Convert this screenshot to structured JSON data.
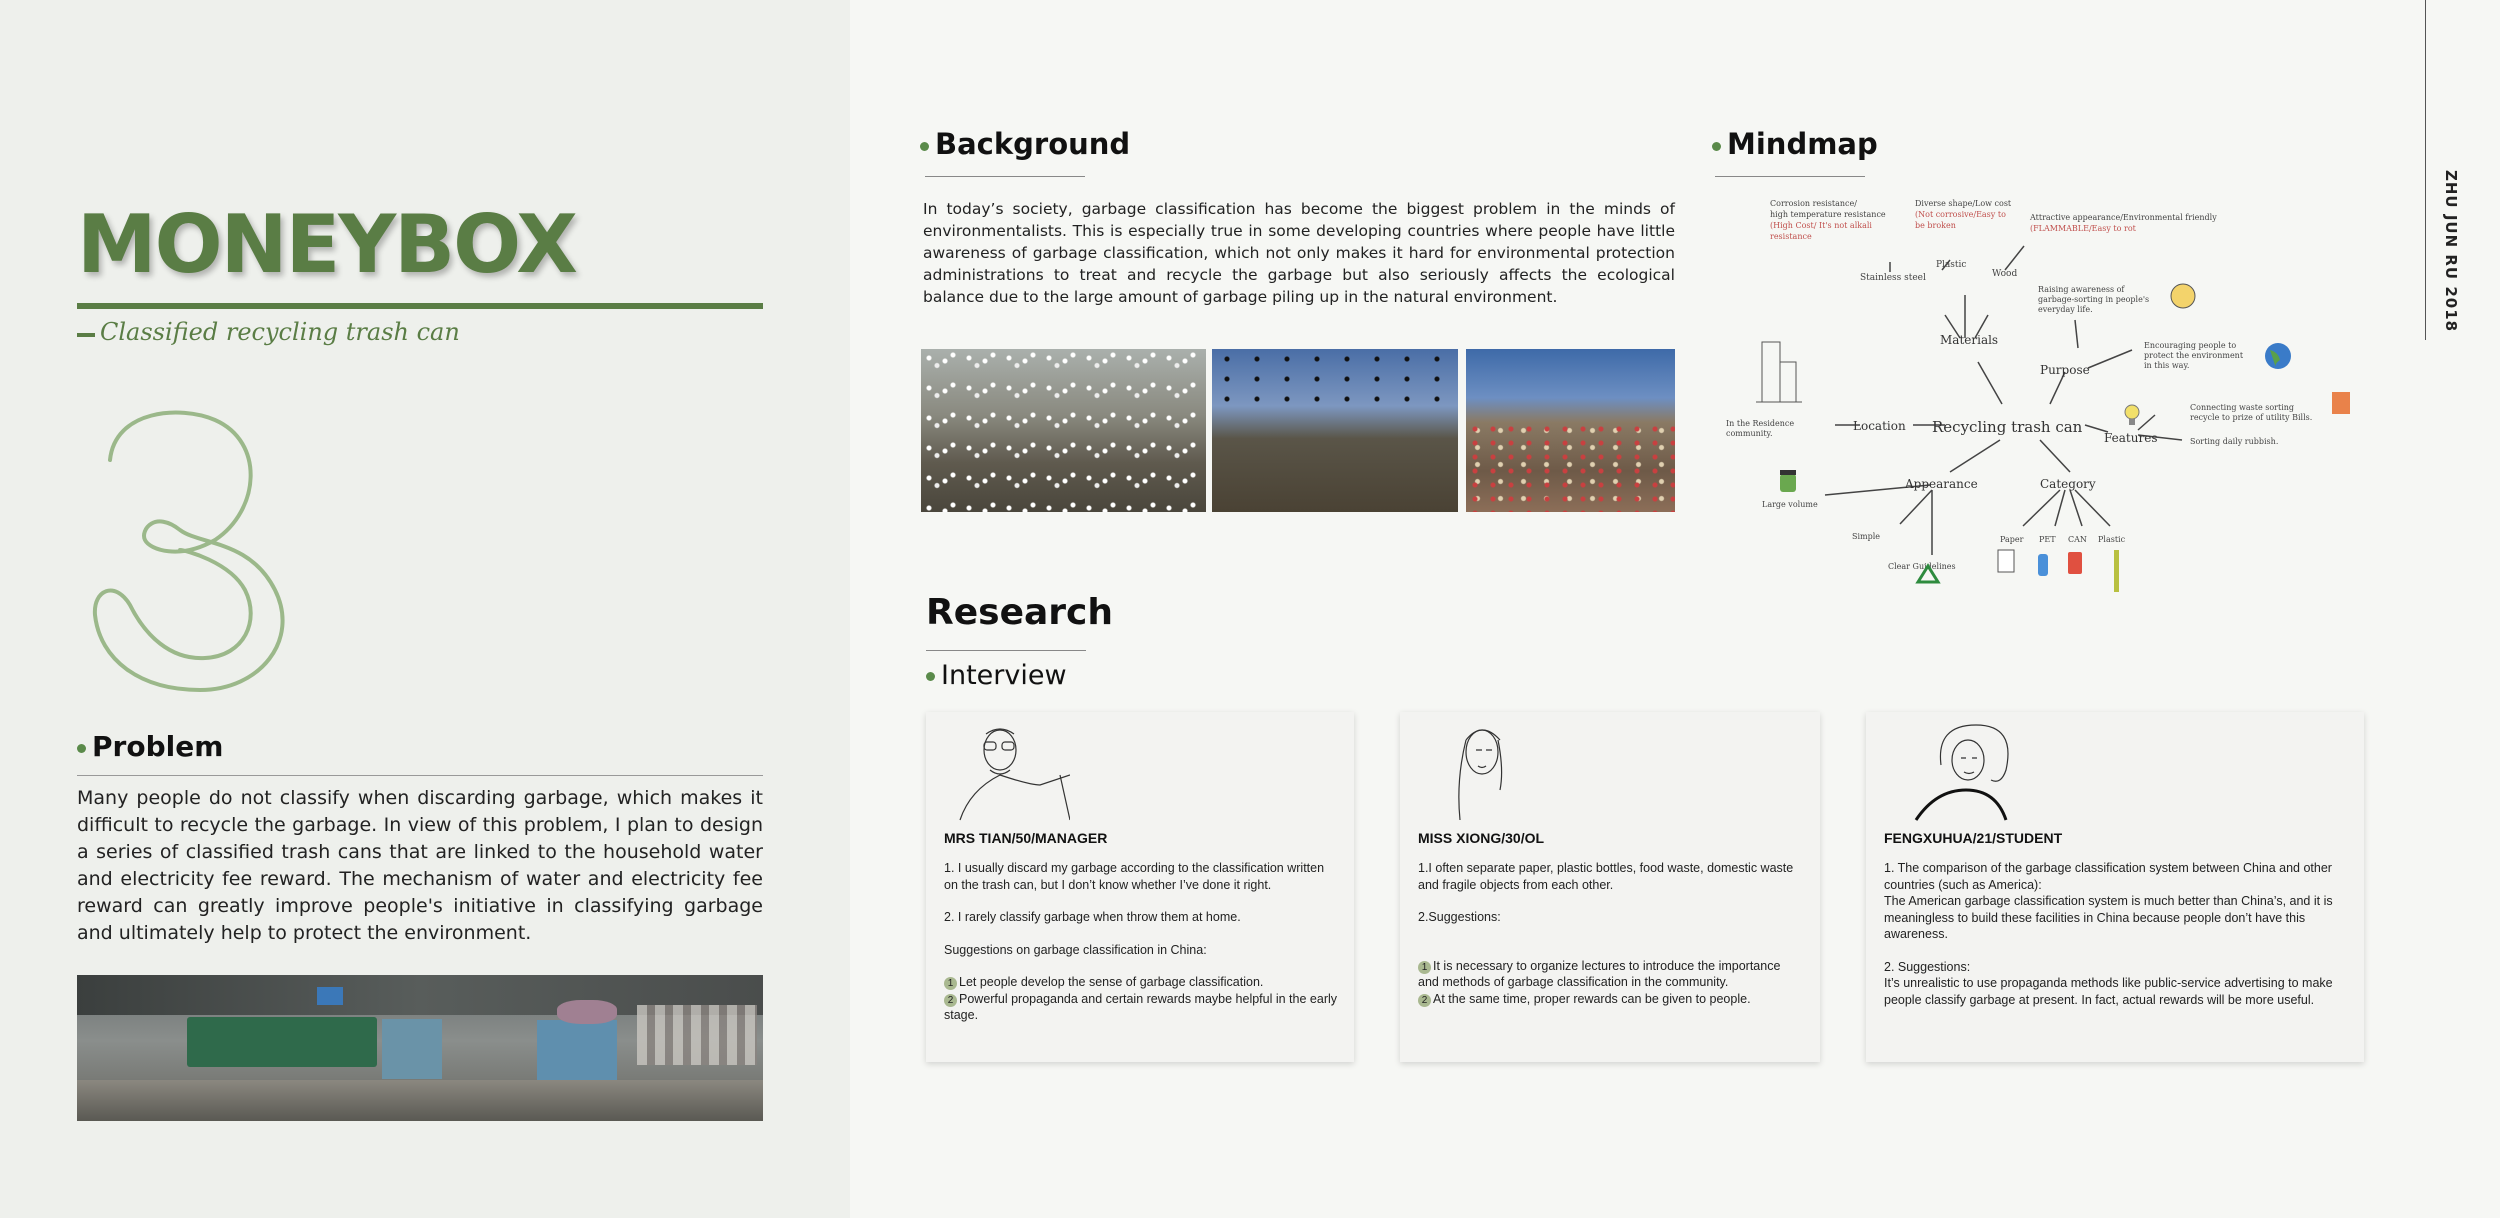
{
  "left": {
    "brand": "MONEYBOX",
    "subtitle": "Classified recycling trash can",
    "problem_title": "Problem",
    "problem_text": "Many people do not classify when discarding garbage, which makes it difficult to recycle the garbage. In view of this problem, I plan to design a series of classified trash cans that are linked to the household water and electricity fee reward. The mechanism of water and electricity fee reward can greatly improve people's initiative in classifying garbage and ultimately help to protect the environment."
  },
  "background": {
    "title": "Background",
    "text": "In today’s society, garbage classification has become the biggest problem in the minds of environmentalists. This is especially true in some developing countries where people have little awareness of garbage classification, which not only makes it hard for environmental protection administrations to treat and recycle the garbage but also seriously affects the ecological balance due to the large amount of garbage piling up in the natural environment."
  },
  "mindmap": {
    "title": "Mindmap",
    "center": "Recycling trash can",
    "materials": "Materials",
    "purpose": "Purpose",
    "location": "Location",
    "features": "Features",
    "appearance": "Appearance",
    "category": "Category",
    "stainless": "Stainless steel",
    "plastic": "Plastic",
    "wood": "Wood",
    "note_steel_1": "Corrosion resistance/",
    "note_steel_2": "high temperature resistance",
    "note_steel_3": "(High Cost/ It's not alkali",
    "note_steel_4": "resistance",
    "note_plastic_1": "Diverse shape/Low cost",
    "note_plastic_2": "(Not corrosive/Easy to",
    "note_plastic_3": "be broken",
    "note_wood_1": "Attractive appearance/Environmental friendly",
    "note_wood_2": "(FLAMMABLE/Easy to rot",
    "purpose_1a": "Raising awareness of",
    "purpose_1b": "garbage-sorting in people's",
    "purpose_1c": "everyday life.",
    "purpose_2a": "Encouraging people to",
    "purpose_2b": "protect the environment",
    "purpose_2c": "in this way.",
    "location_note_1": "In the Residence",
    "location_note_2": "community.",
    "features_1a": "Connecting waste sorting",
    "features_1b": "recycle to prize of utility Bills.",
    "features_2": "Sorting daily rubbish.",
    "large_volume": "Large volume",
    "simple": "Simple",
    "clear_guidelines": "Clear Guidelines",
    "paper": "Paper",
    "pet": "PET",
    "can": "CAN",
    "plastic_cat": "Plastic"
  },
  "research": {
    "title": "Research",
    "interview_title": "Interview",
    "cards": [
      {
        "name": "MRS TIAN/50/MANAGER",
        "p1": "1. I usually discard my garbage according to the classification written on the trash can, but I don’t know whether I’ve done it right.",
        "p2": "2. I rarely classify garbage when throw them at home.",
        "p3": "Suggestions on garbage classification in China:",
        "s1": "Let people develop the sense of garbage classification.",
        "s2": "Powerful propaganda and certain rewards maybe helpful in the early stage."
      },
      {
        "name": "MISS XIONG/30/OL",
        "p1": "1.I often separate paper, plastic bottles, food waste, domestic waste and fragile objects from each other.",
        "p2": "2.Suggestions:",
        "s1": "It is necessary to organize lectures to introduce the importance and methods of garbage classification in the community.",
        "s2": "At the same time, proper rewards can be given to people."
      },
      {
        "name": "FENGXUHUA/21/STUDENT",
        "p1a": "1. The comparison of the garbage classification system between China and other countries (such as America):",
        "p1b": "The American garbage classification system is much better than China’s, and it is meaningless to build these facilities in China because people don’t have this awareness.",
        "p2a": "2. Suggestions:",
        "p2b": "It’s unrealistic to use propaganda methods like public-service advertising to make people classify garbage at present. In fact, actual rewards will be more useful."
      }
    ]
  },
  "side_label": "ZHU JUN RU 2018",
  "bullet_nums": [
    "1",
    "2"
  ],
  "colors": {
    "brand_green": "#5a7d45",
    "outline_green": "#9bb88a",
    "panel": "#eef0ec"
  },
  "icons": [
    "building-icon",
    "head-lightbulb-icon",
    "globe-icon",
    "lightbulb-icon",
    "bill-icon",
    "frankenstein-icon",
    "recycle-icon",
    "paper-icon",
    "bottle-icon",
    "can-icon",
    "straw-icon"
  ]
}
